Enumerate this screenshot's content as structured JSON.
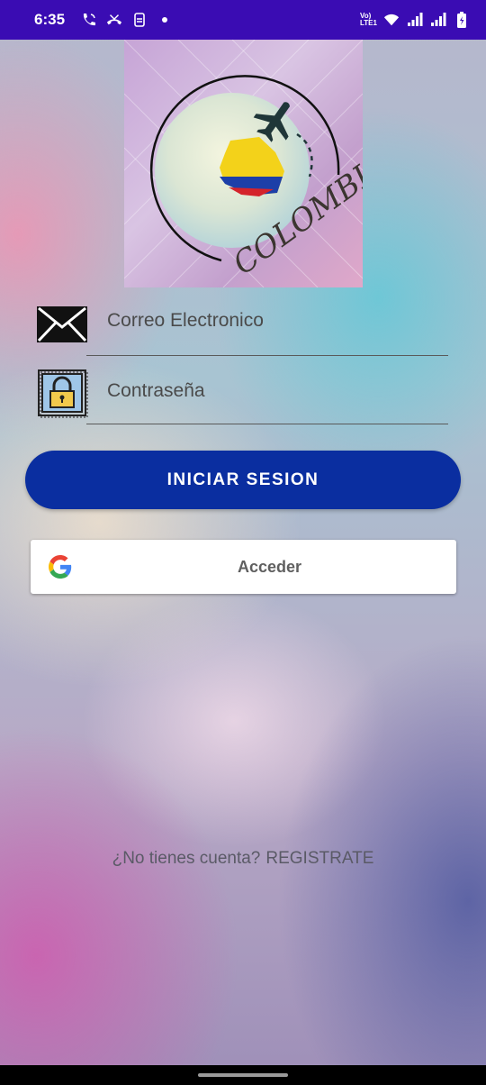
{
  "status_bar": {
    "time": "6:35",
    "icons_left": [
      "wifi-call-icon",
      "missed-call-icon",
      "sim-icon",
      "notification-dot-icon"
    ],
    "icons_right": [
      "volte-icon",
      "wifi-icon",
      "signal-icon",
      "signal-icon",
      "battery-charging-icon"
    ],
    "volte_text": "Vo) LTE1",
    "background": "#3a0cb3"
  },
  "logo": {
    "text": "COLOMBIA"
  },
  "form": {
    "email_label": "Correo Electronico",
    "password_label": "Contraseña"
  },
  "buttons": {
    "login": "INICIAR SESION",
    "google": "Acceder",
    "login_color": "#0a2ea0"
  },
  "register": {
    "question": "¿No tienes cuenta?",
    "link": "REGISTRATE"
  }
}
